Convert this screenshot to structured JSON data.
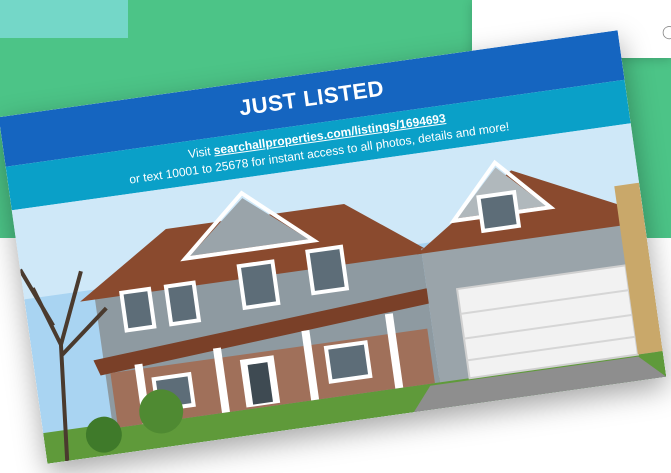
{
  "postcard": {
    "heading": "JUST LISTED",
    "visit_prefix": "Visit ",
    "listing_url": "searchallproperties.com/listings/1694693",
    "text_line": "or text 10001 to 25678 for instant access to all photos, details and more!"
  },
  "colors": {
    "background_green": "#4cc487",
    "teal_accent": "#74d7c8",
    "header_blue": "#1565c0",
    "subheader_cyan": "#0aa0c8"
  },
  "icons": {
    "card_icon": "chat-bubble-icon"
  }
}
